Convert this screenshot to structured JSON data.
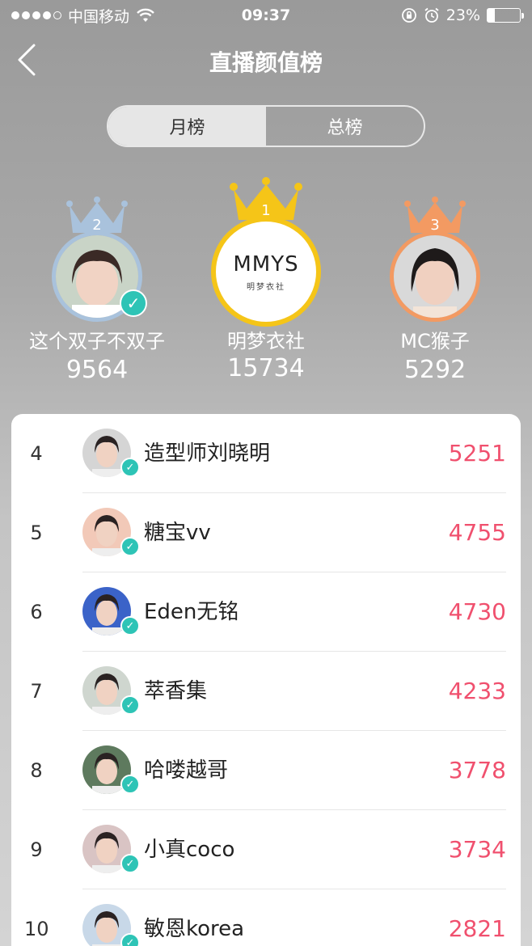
{
  "status_bar": {
    "carrier": "中国移动",
    "time": "09:37",
    "battery_text": "23%",
    "battery_level": 0.23
  },
  "nav": {
    "title": "直播颜值榜",
    "back_icon": "chevron-left-icon"
  },
  "segment": {
    "tabs": [
      "月榜",
      "总榜"
    ],
    "active_index": 0
  },
  "podium": {
    "first": {
      "rank": "1",
      "name": "明梦衣社",
      "score": "15734",
      "logo_main": "MMYS",
      "logo_sub": "明梦衣社",
      "crown_color": "#f5c518"
    },
    "second": {
      "rank": "2",
      "name": "这个双子不双子",
      "score": "9564",
      "verified": true,
      "crown_color": "#a9c2dc"
    },
    "third": {
      "rank": "3",
      "name": "MC猴子",
      "score": "5292",
      "crown_color": "#f39a62"
    }
  },
  "ranking": [
    {
      "rank": "4",
      "name": "造型师刘晓明",
      "score": "5251"
    },
    {
      "rank": "5",
      "name": "糖宝vv",
      "score": "4755"
    },
    {
      "rank": "6",
      "name": "Eden无铭",
      "score": "4730"
    },
    {
      "rank": "7",
      "name": "萃香集",
      "score": "4233"
    },
    {
      "rank": "8",
      "name": "哈喽越哥",
      "score": "3778"
    },
    {
      "rank": "9",
      "name": "小真coco",
      "score": "3734"
    },
    {
      "rank": "10",
      "name": "敏恩korea",
      "score": "2821"
    }
  ],
  "colors": {
    "score": "#f0506e",
    "verify_badge": "#2ec4b6"
  }
}
